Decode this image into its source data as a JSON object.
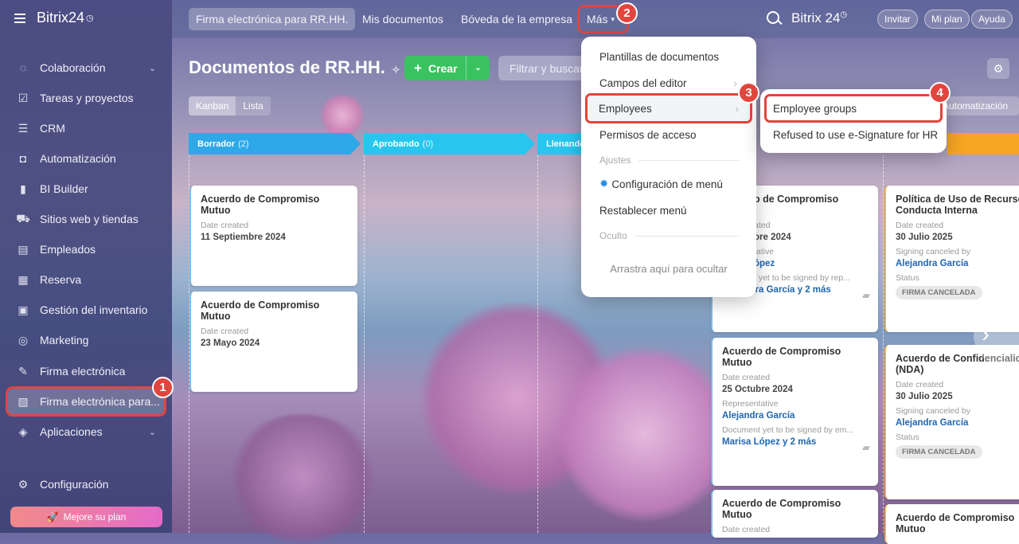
{
  "sidebar": {
    "logo": "Bitrix24",
    "logo_mark": "◷",
    "items": [
      {
        "label": "Colaboración",
        "icon": "chat-icon",
        "chevron": true
      },
      {
        "label": "Tareas y proyectos",
        "icon": "checkbox-icon"
      },
      {
        "label": "CRM",
        "icon": "filter-icon"
      },
      {
        "label": "Automatización",
        "icon": "robot-icon"
      },
      {
        "label": "BI Builder",
        "icon": "bars-icon"
      },
      {
        "label": "Sitios web y tiendas",
        "icon": "cart-icon"
      },
      {
        "label": "Empleados",
        "icon": "id-card-icon"
      },
      {
        "label": "Reserva",
        "icon": "calendar-icon"
      },
      {
        "label": "Gestión del inventario",
        "icon": "box-icon"
      },
      {
        "label": "Marketing",
        "icon": "target-icon"
      },
      {
        "label": "Firma electrónica",
        "icon": "pen-icon"
      },
      {
        "label": "Firma electrónica para...",
        "icon": "doc-sign-icon",
        "active": true
      },
      {
        "label": "Aplicaciones",
        "icon": "cube-icon",
        "chevron": true
      }
    ],
    "settings_label": "Configuración",
    "upgrade_label": "Mejore su plan"
  },
  "topbar": {
    "tabs": [
      "Firma electrónica para RR.HH.",
      "Mis documentos",
      "Bóveda de la empresa",
      "Más"
    ],
    "brand": "Bitrix 24",
    "invite": "Invitar",
    "plan": "Mi plan",
    "help": "Ayuda"
  },
  "page": {
    "title": "Documentos de RR.HH.",
    "create_label": "Crear",
    "filter_placeholder": "Filtrar y buscar",
    "views": [
      "Kanban",
      "Lista"
    ],
    "automation_label": "Automatización"
  },
  "columns": [
    {
      "name": "Borrador",
      "count": "(2)",
      "color": "#2fa8e8"
    },
    {
      "name": "Aprobando",
      "count": "(0)",
      "color": "#28c6ef"
    },
    {
      "name": "Llenando",
      "count": "",
      "color": "#28c6ef"
    },
    {
      "name": "",
      "count": "",
      "color": "#f5a623"
    }
  ],
  "cards": {
    "c1": {
      "title": "Acuerdo de Compromiso Mutuo",
      "label1": "Date created",
      "value1": "11 Septiembre 2024"
    },
    "c2": {
      "title": "Acuerdo de Compromiso Mutuo",
      "label1": "Date created",
      "value1": "23 Mayo 2024"
    },
    "c3": {
      "title": "o de Compromiso",
      "label1": "ated",
      "value1": "ore 2024",
      "label2": "tative",
      "value2": "ópez",
      "label3": "t yet to be signed by rep...",
      "value3": "Alejandra García y 2 más"
    },
    "c4": {
      "title": "Acuerdo de Compromiso Mutuo",
      "label1": "Date created",
      "value1": "25 Octubre 2024",
      "label2": "Representative",
      "value2": "Alejandra García",
      "label3": "Document yet to be signed by em...",
      "value3": "Marisa López y 2 más"
    },
    "c5": {
      "title": "Acuerdo de Compromiso Mutuo",
      "label1": "Date created"
    },
    "c6": {
      "title": "Política de Uso de Recursos y Conducta Interna",
      "label1": "Date created",
      "value1": "30 Julio 2025",
      "label2": "Signing canceled by",
      "value2": "Alejandra García",
      "label3": "Status",
      "status": "FIRMA CANCELADA"
    },
    "c7": {
      "title": "Acuerdo de Confidencialidad (NDA)",
      "label1": "Date created",
      "value1": "30 Julio 2025",
      "label2": "Signing canceled by",
      "value2": "Alejandra García",
      "label3": "Status",
      "status": "FIRMA CANCELADA"
    },
    "c8": {
      "title": "Acuerdo de Compromiso Mutuo"
    }
  },
  "more_menu": {
    "items": [
      "Plantillas de documentos",
      "Campos del editor",
      "Employees",
      "Permisos de acceso"
    ],
    "section_settings": "Ajustes",
    "config_menu": "Configuración de menú",
    "reset_menu": "Restablecer menú",
    "section_hidden": "Oculto",
    "drag_hint": "Arrastra aquí para ocultar"
  },
  "submenu": {
    "items": [
      "Employee groups",
      "Refused to use e-Signature for HR"
    ]
  },
  "badges": [
    "1",
    "2",
    "3",
    "4"
  ],
  "colors": {
    "highlight": "#e2453e",
    "create": "#3bc260",
    "link": "#2066b0"
  }
}
